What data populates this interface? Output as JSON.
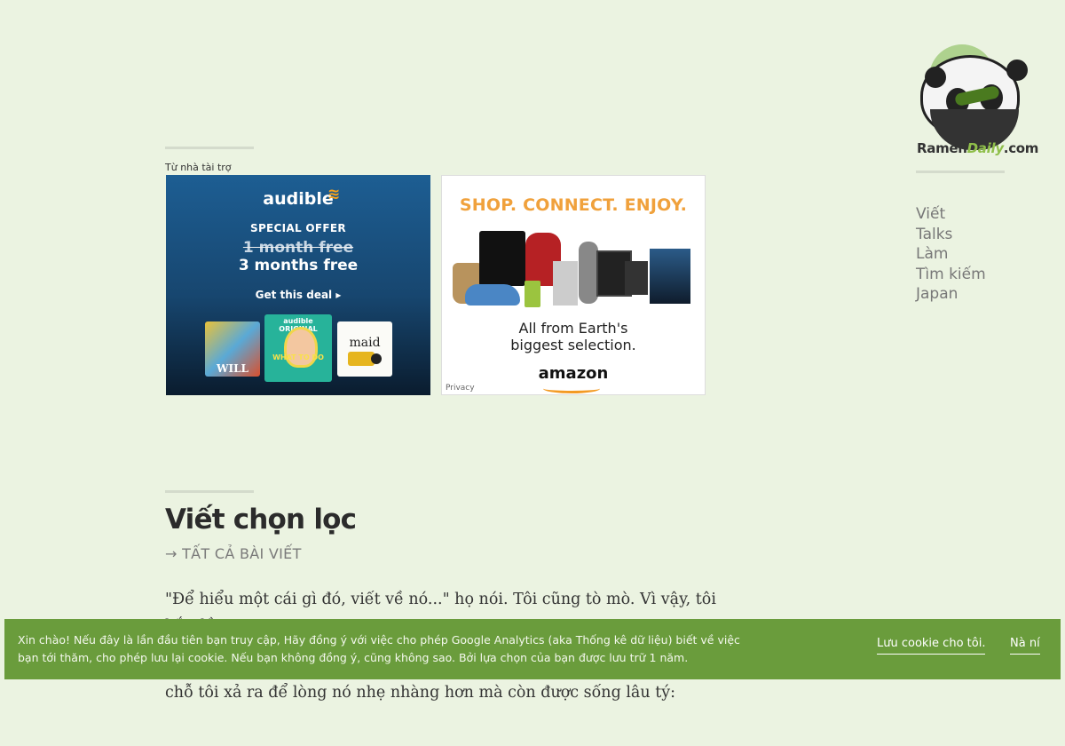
{
  "sponsor": {
    "label": "Từ nhà tài trợ"
  },
  "ads": {
    "audible": {
      "brand": "audible",
      "offer": "SPECIAL OFFER",
      "old_offer": "1 month free",
      "new_offer": "3 months free",
      "cta": "Get this deal ▸",
      "book1": "WILL",
      "book2_header": "audible ORIGINAL",
      "book2_title": "WHAT TO DO",
      "book3_title": "maid"
    },
    "amazon": {
      "slogan": "SHOP. CONNECT. ENJOY.",
      "line1": "All from Earth's",
      "line2": "biggest selection.",
      "logo": "amazon",
      "privacy": "Privacy"
    }
  },
  "logo": {
    "part1": "Ramen",
    "part2": "Daily",
    "part3": ".com"
  },
  "nav": {
    "items": [
      "Viết",
      "Talks",
      "Làm",
      "Tìm kiếm",
      "Japan"
    ]
  },
  "featured": {
    "title": "Viết chọn lọc",
    "all_posts": "→ TẤT CẢ BÀI VIẾT",
    "intro_line1": "\"Để hiểu một cái gì đó, viết về nó...\" họ nói. Tôi cũng tò mò. Vì vậy, tôi bắt đầu",
    "intro_line2": "chỗ tôi xả ra để lòng nó nhẹ nhàng hơn mà còn được sống lâu tý:"
  },
  "cookie": {
    "message": "Xin chào! Nếu đây là lần đầu tiên bạn truy cập, Hãy đồng ý với việc cho phép Google Analytics (aka Thống kê dữ liệu) biết về việc bạn tới thăm, cho phép lưu lại cookie. Nếu bạn không đồng ý, cũng không sao. Bởi lựa chọn của bạn được lưu trữ 1 năm.",
    "accept": "Lưu cookie cho tôi.",
    "decline": "Nà ní"
  }
}
